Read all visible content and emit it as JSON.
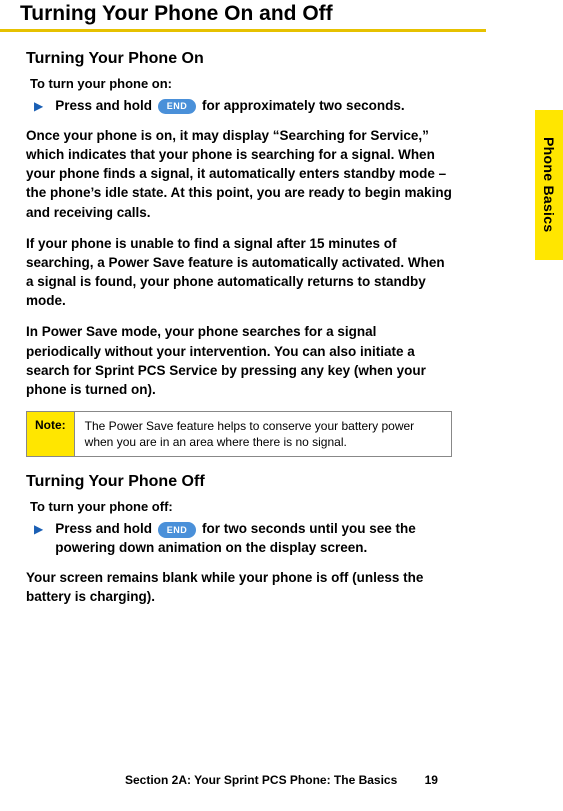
{
  "title": "Turning Your Phone On and Off",
  "side_tab": "Phone Basics",
  "on": {
    "heading": "Turning Your Phone On",
    "sub": "To turn your phone on:",
    "step_before": "Press and hold ",
    "badge": "END",
    "step_after": " for approximately two seconds.",
    "p1": "Once your phone is on, it may display “Searching for Service,” which indicates that your phone is searching for a signal. When your phone finds a signal, it automatically enters standby mode – the phone’s idle state. At this point, you are ready to begin making and receiving calls.",
    "p2": "If your phone is unable to find a signal after 15 minutes of searching, a Power Save feature is automatically activated. When a signal is found, your phone automatically returns to standby mode.",
    "p3": "In Power Save mode, your phone searches for a signal periodically without your intervention. You can also initiate a search for Sprint PCS Service by pressing any key (when your phone is turned on)."
  },
  "note": {
    "label": "Note:",
    "text": "The Power Save feature helps to conserve your battery power when you are in an area where there is no signal."
  },
  "off": {
    "heading": "Turning Your Phone Off",
    "sub": "To turn your phone off:",
    "step_before": "Press and hold ",
    "badge": "END",
    "step_after": " for two seconds until you see the powering down animation on the display screen.",
    "p1": "Your screen remains blank while your phone is off (unless the battery is charging)."
  },
  "footer": {
    "section": "Section 2A: Your Sprint PCS Phone: The Basics",
    "page": "19"
  }
}
